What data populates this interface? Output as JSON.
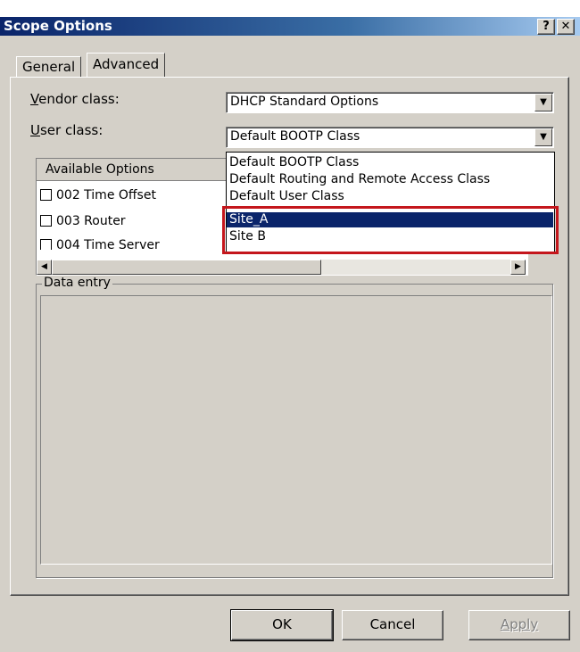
{
  "window": {
    "title": "Scope Options",
    "help_label": "?",
    "close_label": "✕"
  },
  "tabs": [
    {
      "label": "General",
      "active": false
    },
    {
      "label": "Advanced",
      "active": true
    }
  ],
  "vendor_class": {
    "label_underlined": "V",
    "label_rest": "endor class:",
    "value": "DHCP Standard Options"
  },
  "user_class": {
    "label_underlined": "U",
    "label_rest": "ser class:",
    "value": "Default BOOTP Class",
    "options": [
      "Default BOOTP Class",
      "Default Routing and Remote Access Class",
      "Default User Class",
      "Site_A",
      "Site B"
    ],
    "selected": "Site_A"
  },
  "options_list": {
    "header": "Available Options",
    "items": [
      {
        "label": "002 Time Offset",
        "checked": false
      },
      {
        "label": "003 Router",
        "checked": false
      },
      {
        "label": "004 Time Server",
        "checked": false
      }
    ]
  },
  "data_entry": {
    "legend": "Data entry"
  },
  "buttons": {
    "ok": "OK",
    "cancel": "Cancel",
    "apply": "Apply"
  },
  "colors": {
    "highlight_outline": "#c4161c",
    "selection": "#0a246a"
  }
}
